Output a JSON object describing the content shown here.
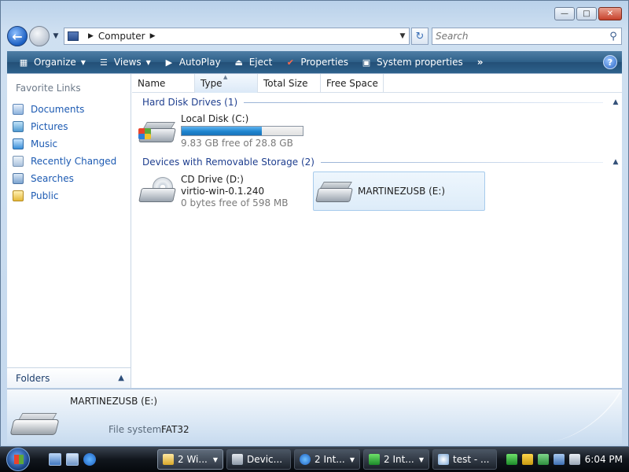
{
  "window": {
    "minimize": "—",
    "maximize": "□",
    "close": "✕"
  },
  "address": {
    "crumb": "Computer",
    "search_placeholder": "Search"
  },
  "toolbar": {
    "organize": "Organize",
    "views": "Views",
    "autoplay": "AutoPlay",
    "eject": "Eject",
    "properties": "Properties",
    "system_properties": "System properties",
    "more": "»",
    "help": "?"
  },
  "sidebar": {
    "title": "Favorite Links",
    "items": [
      {
        "label": "Documents",
        "icon": "documents-icon"
      },
      {
        "label": "Pictures",
        "icon": "pictures-icon"
      },
      {
        "label": "Music",
        "icon": "music-icon"
      },
      {
        "label": "Recently Changed",
        "icon": "recently-changed-icon"
      },
      {
        "label": "Searches",
        "icon": "searches-icon"
      },
      {
        "label": "Public",
        "icon": "public-folder-icon"
      }
    ],
    "folders": "Folders"
  },
  "columns": [
    "Name",
    "Type",
    "Total Size",
    "Free Space"
  ],
  "groups": {
    "hdd": "Hard Disk Drives (1)",
    "removable": "Devices with Removable Storage (2)"
  },
  "drives": {
    "local": {
      "name": "Local Disk (C:)",
      "free": "9.83 GB free of 28.8 GB",
      "used_fraction": 0.66
    },
    "cd": {
      "name": "CD Drive (D:)",
      "label": "virtio-win-0.1.240",
      "free": "0 bytes free of 598 MB"
    },
    "usb": {
      "name": "MARTINEZUSB (E:)"
    }
  },
  "details": {
    "name": "MARTINEZUSB (E:)",
    "fs_label": "File system:",
    "fs_value": "FAT32"
  },
  "taskbar": {
    "tasks": [
      {
        "label": "2 Wi...",
        "icon": "folder-icon",
        "active": true
      },
      {
        "label": "Devic...",
        "icon": "device-manager-icon",
        "active": false
      },
      {
        "label": "2 Int...",
        "icon": "internet-explorer-icon",
        "active": false
      },
      {
        "label": "2 Int...",
        "icon": "flag-icon",
        "active": false
      },
      {
        "label": "test - ...",
        "icon": "paint-icon",
        "active": false
      }
    ],
    "clock": "6:04 PM"
  },
  "colors": {
    "accent": "#1c5ab2",
    "command_bar": "#2d5f88",
    "selection": "#ddecf9",
    "progress": "#1f85cf"
  }
}
